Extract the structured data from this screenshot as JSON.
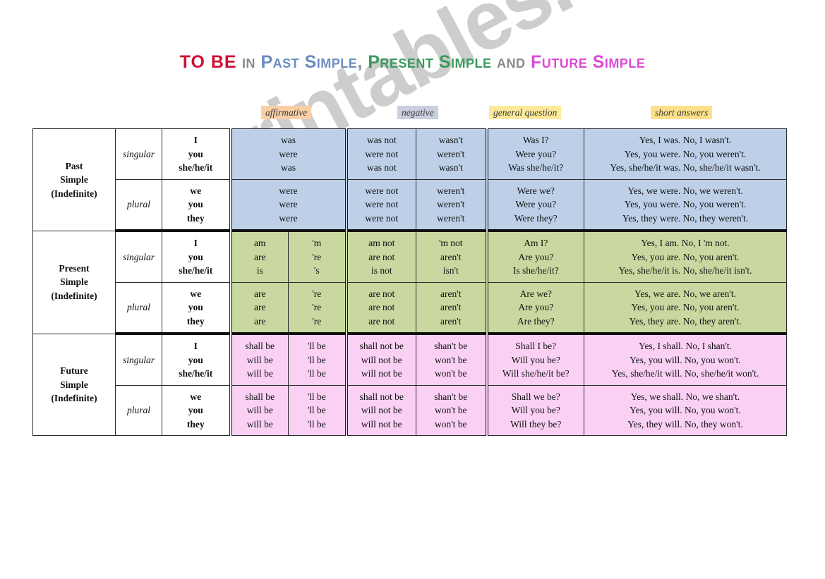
{
  "title": {
    "to_be": "TO BE",
    "in": "in",
    "past": "Past Simple",
    "comma": ",",
    "present": "Present Simple",
    "and": "and",
    "future": "Future Simple"
  },
  "column_tags": {
    "affirmative": "affirmative",
    "negative": "negative",
    "general_question": "general question",
    "short_answers": "short answers"
  },
  "colors": {
    "past_band": "#bdd0e8",
    "present_band": "#c8d8a0",
    "future_band": "#fad1f5",
    "past_title": "#6a8cc4",
    "present_title": "#3a9b5c",
    "future_title": "#dd4ad6",
    "to_be_title": "#cc1133",
    "tag_affirmative_bg": "#fbcfa6",
    "tag_negative_bg": "#c9cee0",
    "tag_general_bg": "#ffe99a",
    "tag_short_bg": "#ffe08a"
  },
  "watermark": "eslprintables.com",
  "labels": {
    "singular": "singular",
    "plural": "plural"
  },
  "pronouns": {
    "singular": "I\nyou\nshe/he/it",
    "plural": "we\nyou\nthey"
  },
  "rows": {
    "past": {
      "name": "Past\nSimple\n(Indefinite)",
      "singular": {
        "number": "singular",
        "pronouns": [
          "I",
          "you",
          "she/he/it"
        ],
        "affirmative_full": [
          "was",
          "were",
          "was"
        ],
        "negative_full": [
          "was not",
          "were not",
          "was not"
        ],
        "negative_short": [
          "wasn't",
          "weren't",
          "wasn't"
        ],
        "question": [
          "Was I?",
          "Were you?",
          "Was she/he/it?"
        ],
        "short_answers": [
          "Yes, I was. No, I wasn't.",
          "Yes, you were. No, you weren't.",
          "Yes, she/he/it was. No, she/he/it wasn't."
        ]
      },
      "plural": {
        "number": "plural",
        "pronouns": [
          "we",
          "you",
          "they"
        ],
        "affirmative_full": [
          "were",
          "were",
          "were"
        ],
        "negative_full": [
          "were not",
          "were not",
          "were not"
        ],
        "negative_short": [
          "weren't",
          "weren't",
          "weren't"
        ],
        "question": [
          "Were we?",
          "Were you?",
          "Were they?"
        ],
        "short_answers": [
          "Yes, we were. No, we weren't.",
          "Yes, you were. No, you weren't.",
          "Yes, they were. No, they weren't."
        ]
      }
    },
    "present": {
      "name": "Present\nSimple\n(Indefinite)",
      "singular": {
        "number": "singular",
        "pronouns": [
          "I",
          "you",
          "she/he/it"
        ],
        "affirmative_full": [
          "am",
          "are",
          "is"
        ],
        "affirmative_short": [
          "'m",
          "'re",
          "'s"
        ],
        "negative_full": [
          "am not",
          "are not",
          "is not"
        ],
        "negative_short": [
          "'m not",
          "aren't",
          "isn't"
        ],
        "question": [
          "Am I?",
          "Are you?",
          "Is she/he/it?"
        ],
        "short_answers": [
          "Yes, I am. No, I 'm not.",
          "Yes, you are. No, you aren't.",
          "Yes, she/he/it is. No, she/he/it isn't."
        ]
      },
      "plural": {
        "number": "plural",
        "pronouns": [
          "we",
          "you",
          "they"
        ],
        "affirmative_full": [
          "are",
          "are",
          "are"
        ],
        "affirmative_short": [
          "'re",
          "'re",
          "'re"
        ],
        "negative_full": [
          "are not",
          "are not",
          "are not"
        ],
        "negative_short": [
          "aren't",
          "aren't",
          "aren't"
        ],
        "question": [
          "Are we?",
          "Are you?",
          "Are they?"
        ],
        "short_answers": [
          "Yes, we are. No, we aren't.",
          "Yes, you are. No, you aren't.",
          "Yes, they are. No, they aren't."
        ]
      }
    },
    "future": {
      "name": "Future\nSimple\n(Indefinite)",
      "singular": {
        "number": "singular",
        "pronouns": [
          "I",
          "you",
          "she/he/it"
        ],
        "affirmative_full": [
          "shall be",
          "will be",
          "will be"
        ],
        "affirmative_short": [
          "'ll be",
          "'ll be",
          "'ll be"
        ],
        "negative_full": [
          "shall not be",
          "will not be",
          "will not be"
        ],
        "negative_short": [
          "shan't be",
          "won't be",
          "won't be"
        ],
        "question": [
          "Shall I be?",
          "Will you be?",
          "Will she/he/it be?"
        ],
        "short_answers": [
          "Yes, I shall. No, I shan't.",
          "Yes, you will. No, you won't.",
          "Yes, she/he/it will. No, she/he/it won't."
        ]
      },
      "plural": {
        "number": "plural",
        "pronouns": [
          "we",
          "you",
          "they"
        ],
        "affirmative_full": [
          "shall be",
          "will be",
          "will be"
        ],
        "affirmative_short": [
          "'ll be",
          "'ll be",
          "'ll be"
        ],
        "negative_full": [
          "shall not be",
          "will not be",
          "will not be"
        ],
        "negative_short": [
          "shan't be",
          "won't be",
          "won't be"
        ],
        "question": [
          "Shall we be?",
          "Will you be?",
          "Will they be?"
        ],
        "short_answers": [
          "Yes, we shall. No, we shan't.",
          "Yes, you will. No, you won't.",
          "Yes, they will. No, they won't."
        ]
      }
    }
  }
}
